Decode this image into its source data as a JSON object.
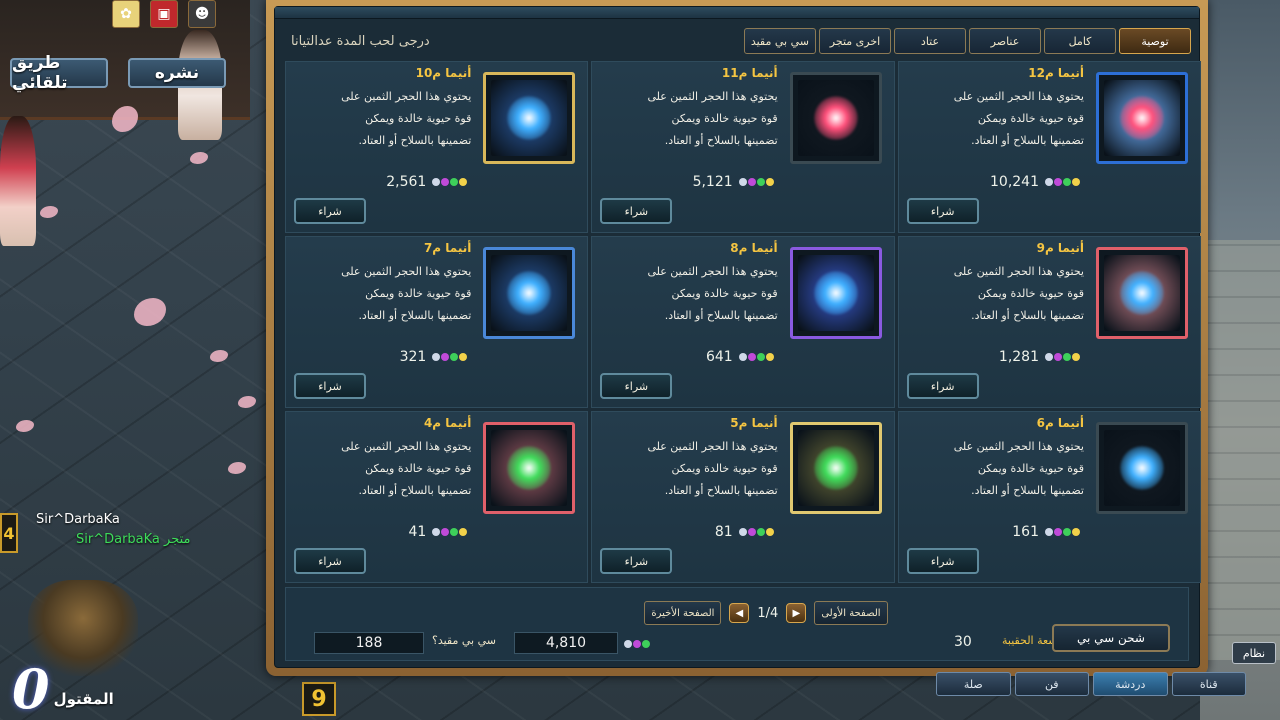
{
  "colors": {
    "accent_gold": "#f5c542",
    "frame_bronze": "#c79a55",
    "panel_bg": "#1b2c37"
  },
  "hud": {
    "auto_path_label": "طريق تلقائي",
    "publish_label": "نشره",
    "player_name": "Sir^DarbaKa",
    "player_name_merchant": "Sir^DarbaKa",
    "merchant_tag": "متجر",
    "level_left": "4",
    "kill_count": "0",
    "kill_label": "المقتول",
    "level_bottom": "9",
    "system_label": "نظام"
  },
  "shop": {
    "title": "درجى لحب المدة عدالتيانا",
    "tabs": [
      {
        "label": "توصية",
        "active": true
      },
      {
        "label": "كامل",
        "active": false
      },
      {
        "label": "عناصر",
        "active": false
      },
      {
        "label": "عتاد",
        "active": false
      },
      {
        "label": "اخرى متجر",
        "active": false
      },
      {
        "label": "سي بي مقيد",
        "active": false
      }
    ],
    "buy_label": "شراء",
    "items": [
      {
        "name": "أنيما م12",
        "price": "10,241",
        "desc": [
          "يحتوي هذا الحجر الثمين على",
          "قوة حيوية خالدة ويمكن",
          "تضمينها بالسلاح أو العتاد."
        ],
        "icon": "red-anima-orb-icon",
        "orb_color": "#ff4f7a",
        "frame": "#2d6fd6",
        "inner": "#6fb0ff"
      },
      {
        "name": "أنيما م11",
        "price": "5,121",
        "desc": [
          "يحتوي هذا الحجر الثمين على",
          "قوة حيوية خالدة ويمكن",
          "تضمينها بالسلاح أو العتاد."
        ],
        "icon": "red-anima-orb-icon",
        "orb_color": "#ff4f7a",
        "frame": "#3a4a52",
        "inner": "#141c24"
      },
      {
        "name": "أنيما م10",
        "price": "2,561",
        "desc": [
          "يحتوي هذا الحجر الثمين على",
          "قوة حيوية خالدة ويمكن",
          "تضمينها بالسلاح أو العتاد."
        ],
        "icon": "blue-anima-orb-icon",
        "orb_color": "#3fb0ff",
        "frame": "#d8b75a",
        "inner": "#2a5aa0"
      },
      {
        "name": "أنيما م9",
        "price": "1,281",
        "desc": [
          "يحتوي هذا الحجر الثمين على",
          "قوة حيوية خالدة ويمكن",
          "تضمينها بالسلاح أو العتاد."
        ],
        "icon": "blue-anima-orb-icon",
        "orb_color": "#3fb0ff",
        "frame": "#e0606a",
        "inner": "#c07a84"
      },
      {
        "name": "أنيما م8",
        "price": "641",
        "desc": [
          "يحتوي هذا الحجر الثمين على",
          "قوة حيوية خالدة ويمكن",
          "تضمينها بالسلاح أو العتاد."
        ],
        "icon": "blue-anima-orb-icon",
        "orb_color": "#3fb0ff",
        "frame": "#8a5ae0",
        "inner": "#3a5ad0"
      },
      {
        "name": "أنيما م7",
        "price": "321",
        "desc": [
          "يحتوي هذا الحجر الثمين على",
          "قوة حيوية خالدة ويمكن",
          "تضمينها بالسلاح أو العتاد."
        ],
        "icon": "blue-anima-orb-icon",
        "orb_color": "#3fb0ff",
        "frame": "#4a88d8",
        "inner": "#2a5aa0"
      },
      {
        "name": "أنيما م6",
        "price": "161",
        "desc": [
          "يحتوي هذا الحجر الثمين على",
          "قوة حيوية خالدة ويمكن",
          "تضمينها بالسلاح أو العتاد."
        ],
        "icon": "blue-anima-orb-icon",
        "orb_color": "#3fb0ff",
        "frame": "#3a4a52",
        "inner": "#141c24"
      },
      {
        "name": "أنيما م5",
        "price": "81",
        "desc": [
          "يحتوي هذا الحجر الثمين على",
          "قوة حيوية خالدة ويمكن",
          "تضمينها بالسلاح أو العتاد."
        ],
        "icon": "green-anima-orb-icon",
        "orb_color": "#3edc5a",
        "frame": "#e0c870",
        "inner": "#6a6a3a"
      },
      {
        "name": "أنيما م4",
        "price": "41",
        "desc": [
          "يحتوي هذا الحجر الثمين على",
          "قوة حيوية خالدة ويمكن",
          "تضمينها بالسلاح أو العتاد."
        ],
        "icon": "green-anima-orb-icon",
        "orb_color": "#3edc5a",
        "frame": "#e0606a",
        "inner": "#a05a64"
      }
    ],
    "footer": {
      "first_page": "الصفحة الأولى",
      "last_page": "الصفحة الأخيرة",
      "page_indicator": "1/4",
      "bag_capacity_label": "سعة الحقيبة:",
      "bag_capacity_value": "30",
      "cp_balance": "4,810",
      "bound_cp_label": "سي بي مقيد؟",
      "bound_cp_value": "188",
      "recharge_label": "شحن سي بي"
    }
  },
  "bottom_tabs": [
    {
      "label": "قناة",
      "active": false
    },
    {
      "label": "دردشة",
      "active": true
    },
    {
      "label": "فن",
      "active": false
    },
    {
      "label": "صلة",
      "active": false
    }
  ]
}
